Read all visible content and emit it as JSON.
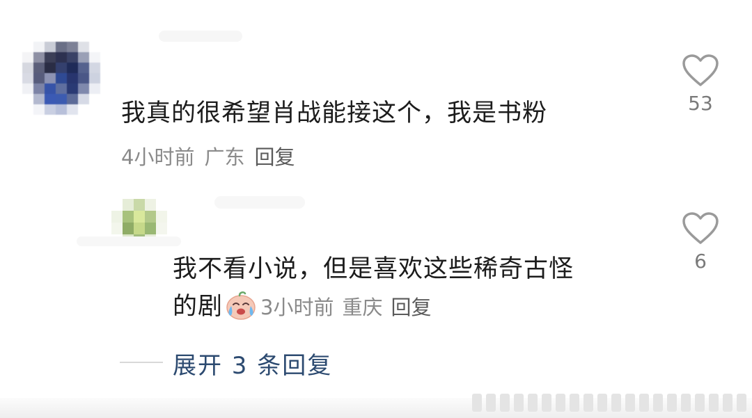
{
  "comment": {
    "text": "我真的很希望肖战能接这个，我是书粉",
    "time": "4小时前",
    "location": "广东",
    "reply_label": "回复",
    "likes": "53",
    "like_icon": "heart-outline-icon"
  },
  "reply": {
    "text_line1": "我不看小说，但是喜欢这些稀奇古怪",
    "text_line2": "的剧",
    "emoji": "crying-laughing-emoji",
    "time": "3小时前",
    "location": "重庆",
    "reply_label": "回复",
    "likes": "6",
    "like_icon": "heart-outline-icon"
  },
  "expand": {
    "label": "展开 3 条回复"
  },
  "colors": {
    "text": "#1c1c1c",
    "meta": "#8a8a8a",
    "expand": "#2c4a70",
    "heart": "#9a9a9a"
  }
}
